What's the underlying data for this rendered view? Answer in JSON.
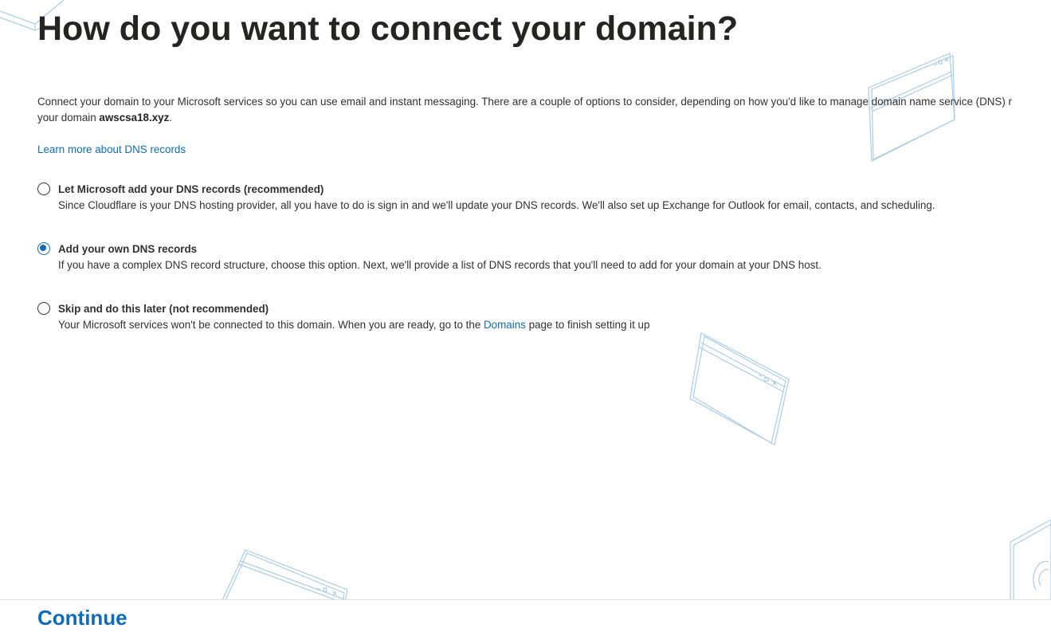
{
  "header": {
    "title": "How do you want to connect your domain?"
  },
  "intro": {
    "line1": "Connect your domain to your Microsoft services so you can use email and instant messaging. There are a couple of options to consider, depending on how you'd like to manage domain name service (DNS) r",
    "line2_prefix": "your domain ",
    "domain": "awscsa18.xyz",
    "line2_suffix": "."
  },
  "learn_more": "Learn more about DNS records",
  "options": [
    {
      "label": "Let Microsoft add your DNS records (recommended)",
      "description": "Since Cloudflare is your DNS hosting provider, all you have to do is sign in and we'll update your DNS records. We'll also set up Exchange for Outlook for email, contacts, and scheduling.",
      "checked": false
    },
    {
      "label": "Add your own DNS records",
      "description": "If you have a complex DNS record structure, choose this option. Next, we'll provide a list of DNS records that you'll need to add for your domain at your DNS host.",
      "checked": true
    },
    {
      "label": "Skip and do this later (not recommended)",
      "description_prefix": "Your Microsoft services won't be connected to this domain. When you are ready, go to the ",
      "description_link": "Domains",
      "description_suffix": " page to finish setting it up",
      "checked": false
    }
  ],
  "footer": {
    "continue_label": "Continue"
  },
  "colors": {
    "accent": "#0f6cbd",
    "text": "#323130",
    "decoration": "#a9cdea"
  }
}
